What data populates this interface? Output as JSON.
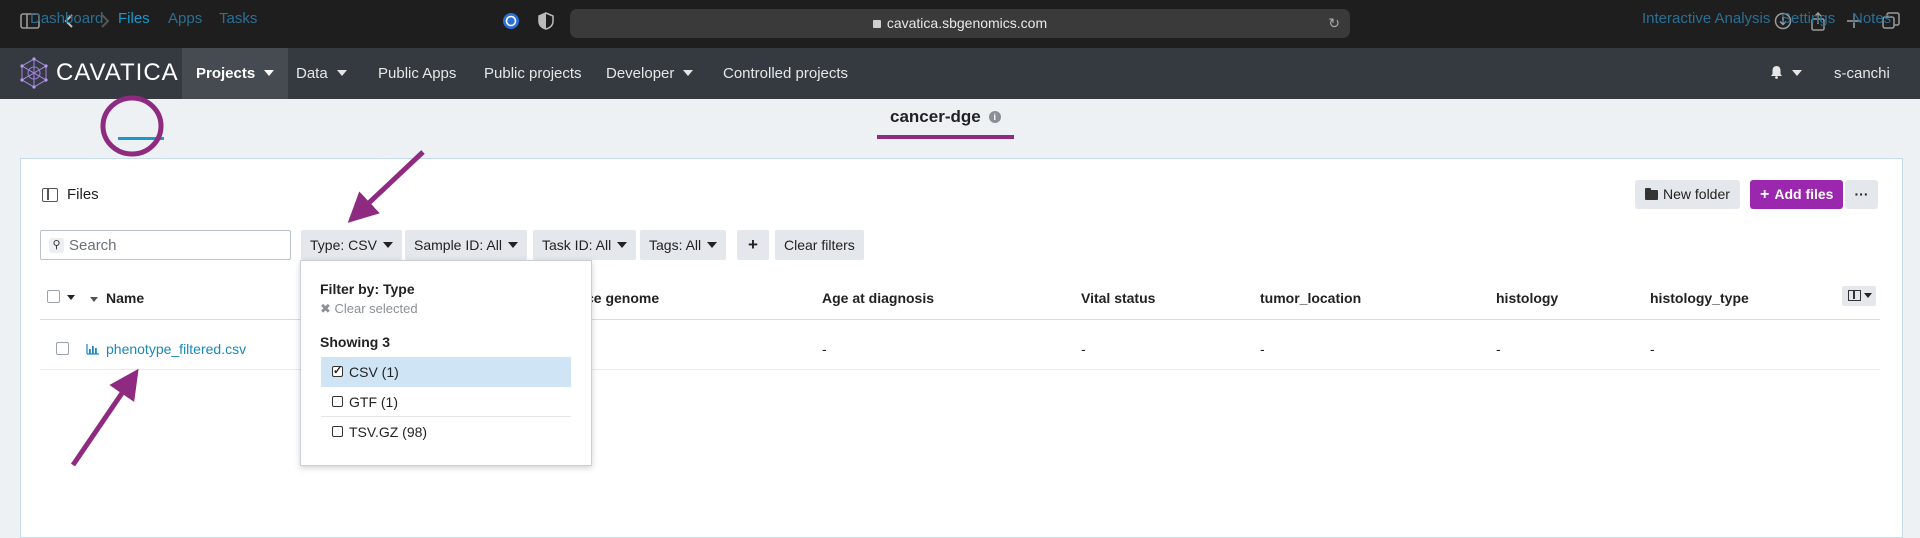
{
  "browser": {
    "url": "cavatica.sbgenomics.com",
    "icons": [
      "sidebar-icon",
      "back-icon",
      "forward-icon",
      "extension-icon",
      "shield-icon",
      "reload-icon",
      "download-icon",
      "share-icon",
      "new-tab-icon",
      "tabs-icon"
    ]
  },
  "app": {
    "brand": "CAVATICA",
    "nav": [
      "Projects",
      "Data",
      "Public Apps",
      "Public projects",
      "Developer",
      "Controlled projects"
    ],
    "user": "s-canchi"
  },
  "project": {
    "tabs": [
      "Dashboard",
      "Files",
      "Apps",
      "Tasks"
    ],
    "active_tab": "Files",
    "title": "cancer-dge",
    "right_links": [
      "Interactive Analysis",
      "Settings",
      "Notes"
    ]
  },
  "files": {
    "heading": "Files",
    "new_folder": "New folder",
    "add_files": "Add files",
    "more": "···",
    "search_placeholder": "Search",
    "filters": [
      "Type: CSV",
      "Sample ID: All",
      "Task ID: All",
      "Tags: All"
    ],
    "add_filter": "+",
    "clear_filters": "Clear filters",
    "columns": [
      "Name",
      "ce genome",
      "Age at diagnosis",
      "Vital status",
      "tumor_location",
      "histology",
      "histology_type"
    ],
    "rows": [
      {
        "name": "phenotype_filtered.csv",
        "age": "-",
        "vital": "-",
        "tumor_location": "-",
        "histology": "-",
        "histology_type": "-"
      }
    ]
  },
  "type_dropdown": {
    "title": "Filter by: Type",
    "clear": "✖ Clear selected",
    "showing": "Showing 3",
    "options": [
      {
        "label": "CSV (1)",
        "checked": true
      },
      {
        "label": "GTF (1)",
        "checked": false
      },
      {
        "label": "TSV.GZ (98)",
        "checked": false
      }
    ]
  },
  "colors": {
    "accent_purple": "#9b27af",
    "annotation": "#8e2a80",
    "link_blue": "#1a88bd",
    "nav_dark": "#343a40"
  }
}
